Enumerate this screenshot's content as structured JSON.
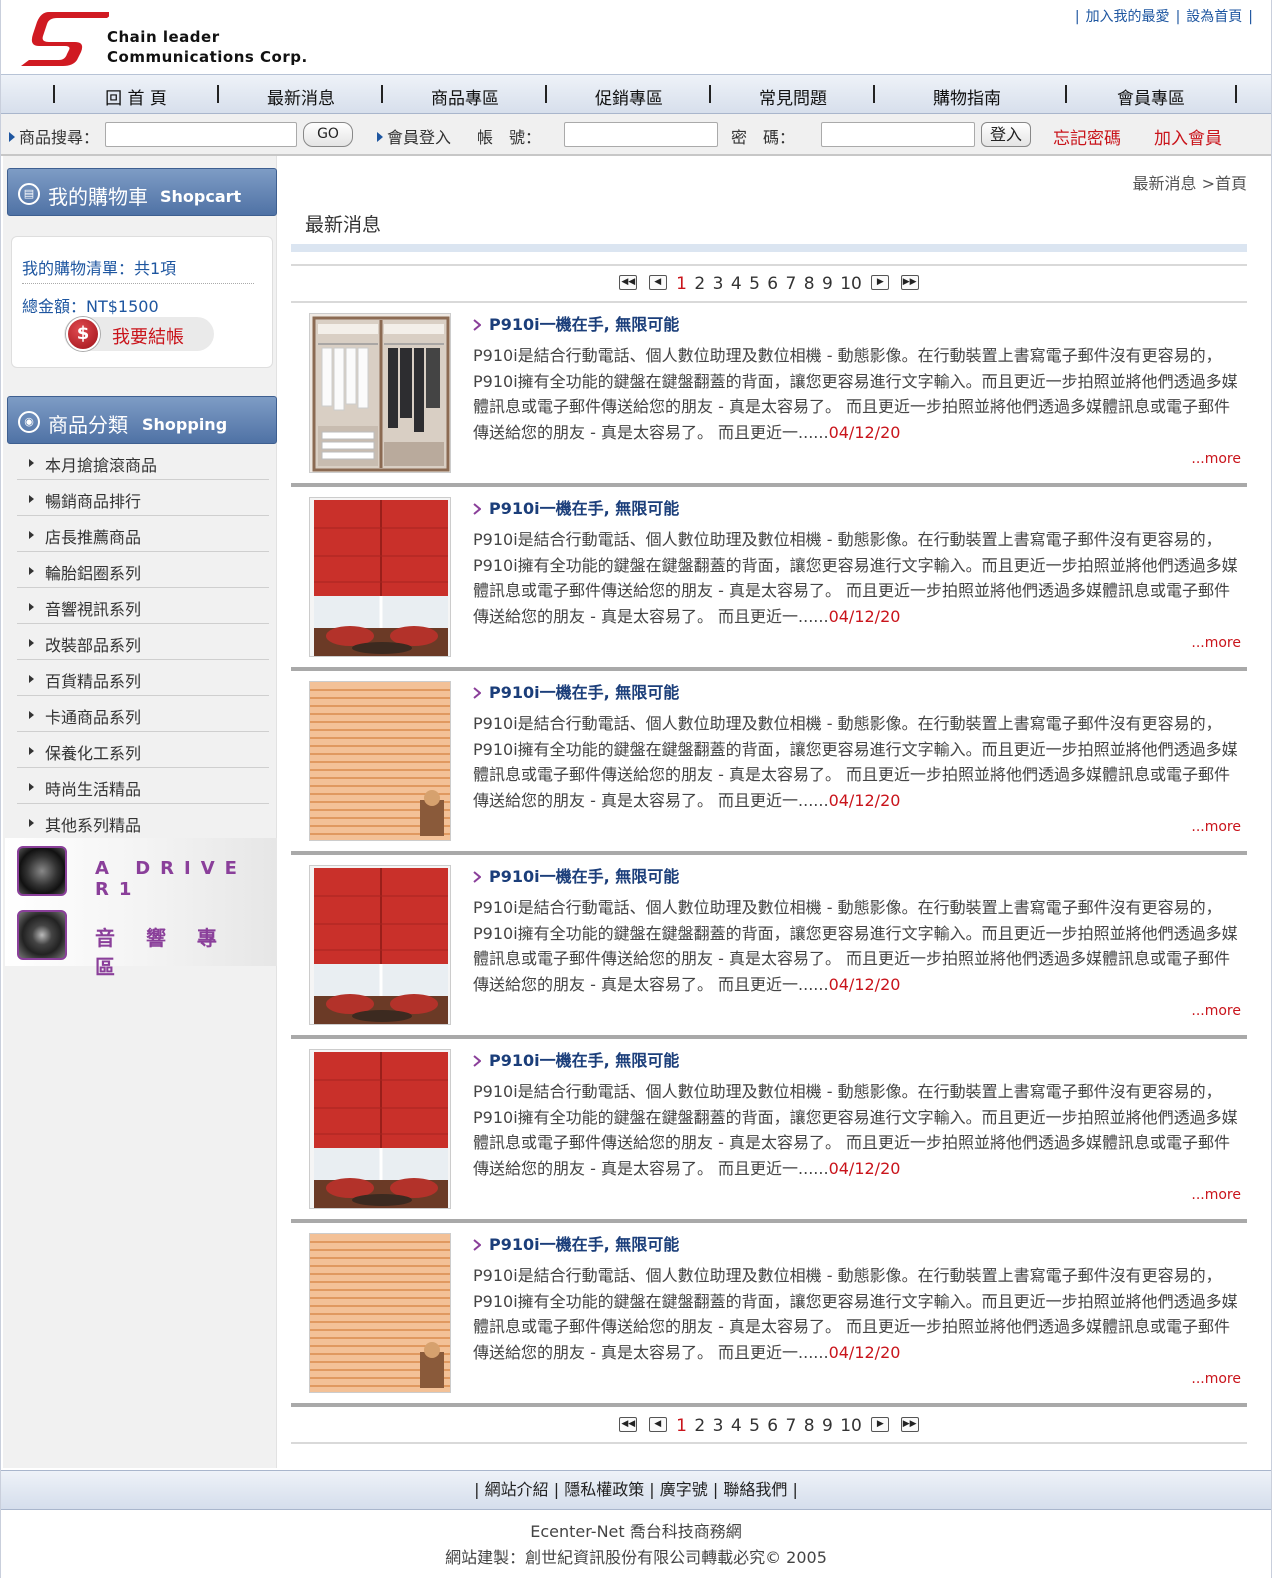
{
  "header": {
    "logo_line1": "Chain leader",
    "logo_line2": "Communications Corp.",
    "links": [
      "加入我的最愛",
      "設為首頁"
    ]
  },
  "nav": [
    "回 首 頁",
    "最新消息",
    "商品專區",
    "促銷專區",
    "常見問題",
    "購物指南",
    "會員專區"
  ],
  "search": {
    "label": "商品搜尋：",
    "go": "GO",
    "login_label": "會員登入",
    "account_label": "帳　號：",
    "password_label": "密　碼：",
    "login_button": "登入",
    "forgot": "忘記密碼",
    "join": "加入會員"
  },
  "cart": {
    "title_zh": "我的購物車",
    "title_en": "Shopcart",
    "list": "我的購物清單：共1項",
    "total": "總金額：NT$1500",
    "checkout": "我要結帳"
  },
  "categories": {
    "title_zh": "商品分類",
    "title_en": "Shopping",
    "items": [
      "本月搶搶滾商品",
      "暢銷商品排行",
      "店長推薦商品",
      "輪胎鋁圈系列",
      "音響視訊系列",
      "改裝部品系列",
      "百貨精品系列",
      "卡通商品系列",
      "保養化工系列",
      "時尚生活精品",
      "其他系列精品"
    ]
  },
  "banners": [
    "A DRIVE R1",
    "音 響 專 區"
  ],
  "main": {
    "breadcrumb": "最新消息 >首頁",
    "title": "最新消息",
    "pager": {
      "pages": [
        "1",
        "2",
        "3",
        "4",
        "5",
        "6",
        "7",
        "8",
        "9",
        "10"
      ],
      "current": "1"
    },
    "items": [
      {
        "image": "wardrobe",
        "title": "P910i一機在手, 無限可能",
        "desc": "P910i是結合行動電話、個人數位助理及數位相機 - 動態影像。在行動裝置上書寫電子郵件沒有更容易的，P910i擁有全功能的鍵盤在鍵盤翻蓋的背面，讓您更容易進行文字輸入。而且更近一步拍照並將他們透過多媒體訊息或電子郵件傳送給您的朋友 - 真是太容易了。 而且更近一步拍照並將他們透過多媒體訊息或電子郵件傳送給您的朋友 - 真是太容易了。 而且更近一......",
        "date": "04/12/20",
        "more": "...more"
      },
      {
        "image": "red-shade",
        "title": "P910i一機在手, 無限可能",
        "desc": "P910i是結合行動電話、個人數位助理及數位相機 - 動態影像。在行動裝置上書寫電子郵件沒有更容易的，P910i擁有全功能的鍵盤在鍵盤翻蓋的背面，讓您更容易進行文字輸入。而且更近一步拍照並將他們透過多媒體訊息或電子郵件傳送給您的朋友 - 真是太容易了。 而且更近一步拍照並將他們透過多媒體訊息或電子郵件傳送給您的朋友 - 真是太容易了。 而且更近一......",
        "date": "04/12/20",
        "more": "...more"
      },
      {
        "image": "blinds",
        "title": "P910i一機在手, 無限可能",
        "desc": "P910i是結合行動電話、個人數位助理及數位相機 - 動態影像。在行動裝置上書寫電子郵件沒有更容易的，P910i擁有全功能的鍵盤在鍵盤翻蓋的背面，讓您更容易進行文字輸入。而且更近一步拍照並將他們透過多媒體訊息或電子郵件傳送給您的朋友 - 真是太容易了。 而且更近一步拍照並將他們透過多媒體訊息或電子郵件傳送給您的朋友 - 真是太容易了。 而且更近一......",
        "date": "04/12/20",
        "more": "...more"
      },
      {
        "image": "red-shade",
        "title": "P910i一機在手, 無限可能",
        "desc": "P910i是結合行動電話、個人數位助理及數位相機 - 動態影像。在行動裝置上書寫電子郵件沒有更容易的，P910i擁有全功能的鍵盤在鍵盤翻蓋的背面，讓您更容易進行文字輸入。而且更近一步拍照並將他們透過多媒體訊息或電子郵件傳送給您的朋友 - 真是太容易了。 而且更近一步拍照並將他們透過多媒體訊息或電子郵件傳送給您的朋友 - 真是太容易了。 而且更近一......",
        "date": "04/12/20",
        "more": "...more"
      },
      {
        "image": "red-shade",
        "title": "P910i一機在手, 無限可能",
        "desc": "P910i是結合行動電話、個人數位助理及數位相機 - 動態影像。在行動裝置上書寫電子郵件沒有更容易的，P910i擁有全功能的鍵盤在鍵盤翻蓋的背面，讓您更容易進行文字輸入。而且更近一步拍照並將他們透過多媒體訊息或電子郵件傳送給您的朋友 - 真是太容易了。 而且更近一步拍照並將他們透過多媒體訊息或電子郵件傳送給您的朋友 - 真是太容易了。 而且更近一......",
        "date": "04/12/20",
        "more": "...more"
      },
      {
        "image": "blinds",
        "title": "P910i一機在手, 無限可能",
        "desc": "P910i是結合行動電話、個人數位助理及數位相機 - 動態影像。在行動裝置上書寫電子郵件沒有更容易的，P910i擁有全功能的鍵盤在鍵盤翻蓋的背面，讓您更容易進行文字輸入。而且更近一步拍照並將他們透過多媒體訊息或電子郵件傳送給您的朋友 - 真是太容易了。 而且更近一步拍照並將他們透過多媒體訊息或電子郵件傳送給您的朋友 - 真是太容易了。 而且更近一......",
        "date": "04/12/20",
        "more": "...more"
      }
    ]
  },
  "footer": {
    "links": [
      "網站介紹",
      "隱私權政策",
      "廣字號",
      "聯絡我們"
    ],
    "line1": "Ecenter-Net 喬台科技商務網",
    "line2": "網站建製：創世紀資訊股份有限公司轉載必究© 2005"
  },
  "colors": {
    "accent_red": "#c9141b",
    "link_blue": "#1e56a0",
    "title_blue": "#1b3e7a"
  }
}
